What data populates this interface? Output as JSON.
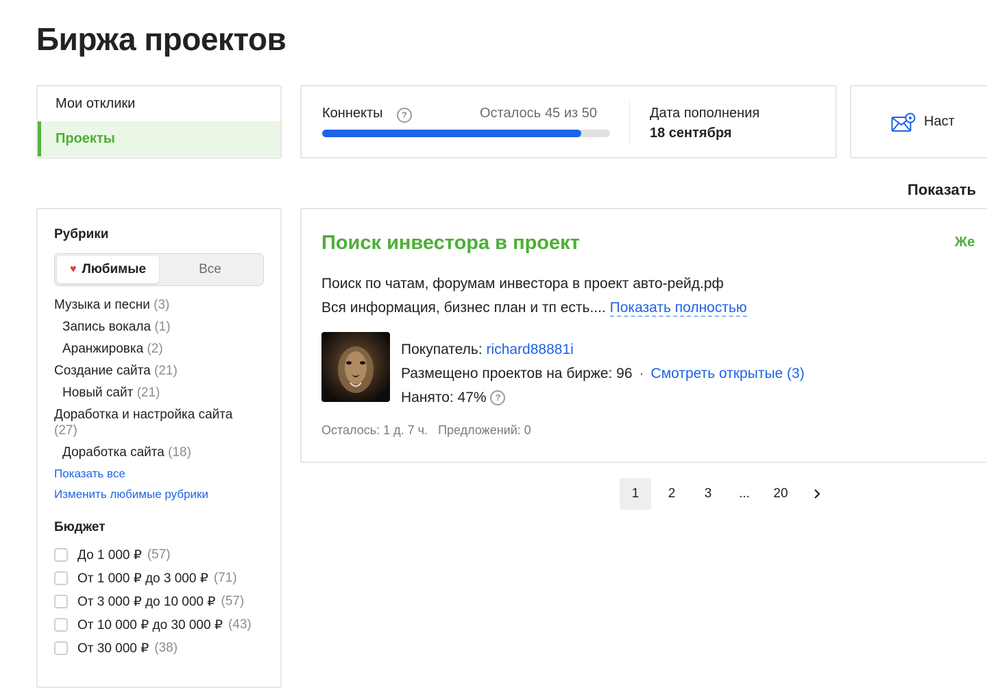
{
  "page": {
    "title": "Биржа проектов"
  },
  "nav": {
    "items": [
      {
        "label": "Мои отклики",
        "active": false
      },
      {
        "label": "Проекты",
        "active": true
      }
    ]
  },
  "connects": {
    "label": "Коннекты",
    "left_label": "Осталось",
    "left_value": "45 из 50",
    "remaining": 45,
    "total": 50,
    "refill_label": "Дата пополнения",
    "refill_date": "18 сентября"
  },
  "settings": {
    "label": "Наст"
  },
  "show_label": "Показать",
  "filters": {
    "rubrics_title": "Рубрики",
    "segment": {
      "favorites": "Любимые",
      "all": "Все",
      "selected": "favorites"
    },
    "categories": [
      {
        "name": "Музыка и песни",
        "count": "(3)",
        "sub": false
      },
      {
        "name": "Запись вокала",
        "count": "(1)",
        "sub": true
      },
      {
        "name": "Аранжировка",
        "count": "(2)",
        "sub": true
      },
      {
        "name": "Создание сайта",
        "count": "(21)",
        "sub": false
      },
      {
        "name": "Новый сайт",
        "count": "(21)",
        "sub": true
      },
      {
        "name": "Доработка и настройка сайта",
        "count": "(27)",
        "sub": false
      },
      {
        "name": "Доработка сайта",
        "count": "(18)",
        "sub": true
      }
    ],
    "show_all": "Показать все",
    "edit_favorites": "Изменить любимые рубрики",
    "budget_title": "Бюджет",
    "budget": [
      {
        "label": "До 1 000 ₽",
        "count": "(57)"
      },
      {
        "label": "От 1 000 ₽ до 3 000 ₽",
        "count": "(71)"
      },
      {
        "label": "От 3 000 ₽ до 10 000 ₽",
        "count": "(57)"
      },
      {
        "label": "От 10 000 ₽ до 30 000 ₽",
        "count": "(43)"
      },
      {
        "label": "От 30 000 ₽",
        "count": "(38)"
      }
    ]
  },
  "project": {
    "title": "Поиск инвестора в проект",
    "price_label": "Же",
    "desc_line1": "Поиск по чатам, форумам инвестора в проект авто-рейд.рф",
    "desc_line2": "Вся информация, бизнес план и тп есть....",
    "more_link": "Показать полностью",
    "buyer_label": "Покупатель:",
    "buyer_name": "richard88881i",
    "posted_label": "Размещено проектов на бирже: 96",
    "open_link": "Смотреть открытые (3)",
    "hired_label": "Нанято: 47%",
    "time_left": "Осталось: 1 д. 7 ч.",
    "offers": "Предложений: 0"
  },
  "pagination": {
    "pages": [
      "1",
      "2",
      "3",
      "...",
      "20"
    ],
    "current": "1"
  },
  "colors": {
    "accent_green": "#4caf36",
    "link_blue": "#1e63e6",
    "progress_blue": "#1e63e6"
  }
}
